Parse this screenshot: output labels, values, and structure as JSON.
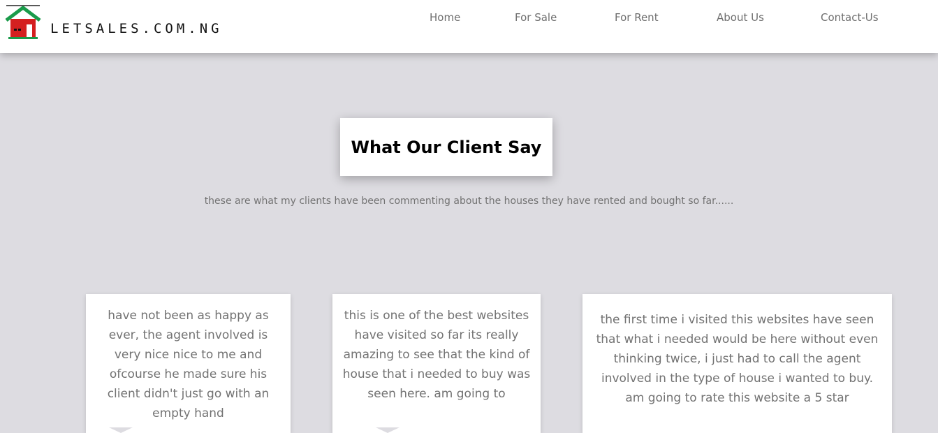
{
  "brand": {
    "name": "LETSALES.COM.NG",
    "logo_icon": "red-house-icon",
    "colors": {
      "roof": "#1a9b4a",
      "house": "#d42020"
    }
  },
  "nav": {
    "home": "Home",
    "for_sale": "For Sale",
    "for_rent": "For Rent",
    "about": "About Us",
    "contact": "Contact-Us"
  },
  "section": {
    "title": "What Our Client Say",
    "subtitle": "these are what my clients have been commenting about the houses they have rented and bought so far......"
  },
  "testimonials": [
    {
      "text": "have not been as happy as ever, the agent involved is very nice nice to me and ofcourse he made sure his client didn't just go with an empty hand"
    },
    {
      "text": "this is one of the best websites have visited so far its really amazing to see that the kind of house that i needed to buy was seen here. am going to"
    },
    {
      "text": "the first time i visited this websites have seen that what i needed would be here without even thinking twice, i just had to call the agent involved in the type of house i wanted to buy. am going to rate this website a 5 star"
    }
  ]
}
